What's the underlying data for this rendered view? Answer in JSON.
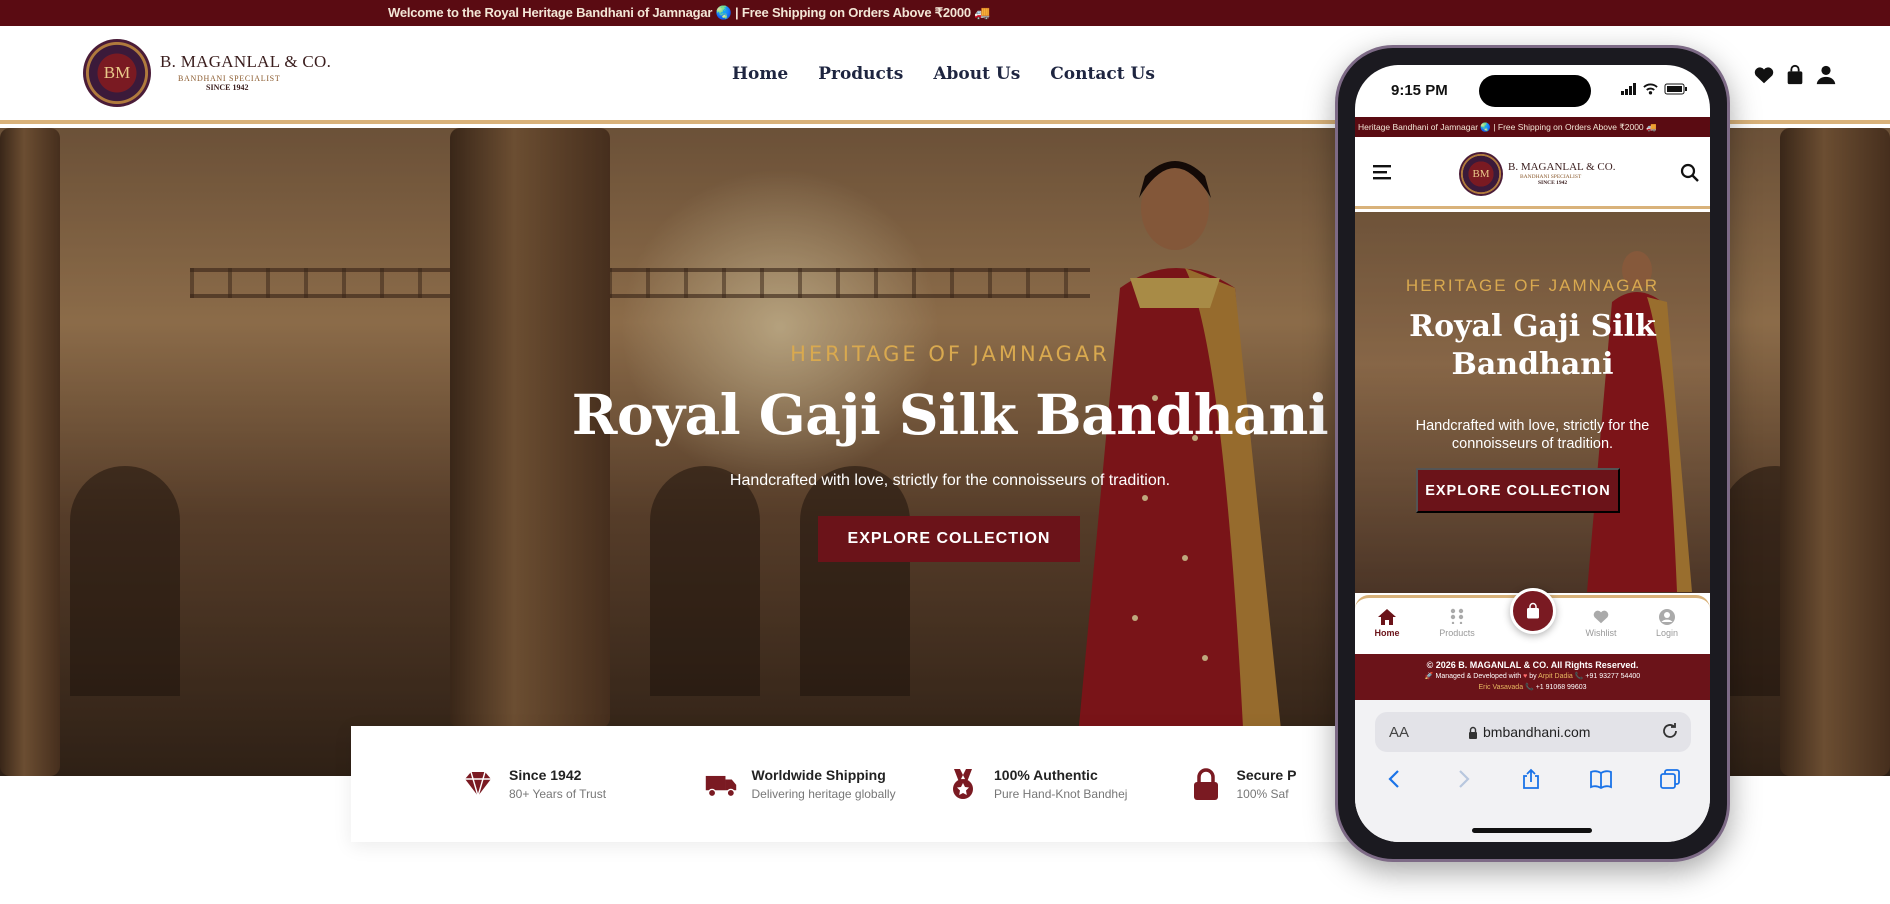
{
  "announcement": "Welcome to the Royal Heritage Bandhani of Jamnagar 🌏 | Free Shipping on Orders Above ₹2000 🚚",
  "brand": {
    "monogram": "BM",
    "name": "B. MAGANLAL & CO.",
    "tagline": "BANDHANI SPECIALIST",
    "since": "SINCE 1942"
  },
  "nav": {
    "items": [
      "Home",
      "Products",
      "About Us",
      "Contact Us"
    ]
  },
  "header_icons": [
    "heart-icon",
    "bag-icon",
    "user-icon"
  ],
  "hero": {
    "eyebrow": "HERITAGE OF JAMNAGAR",
    "title": "Royal Gaji Silk Bandhani",
    "subtitle": "Handcrafted with love, strictly for the connoisseurs of tradition.",
    "cta": "EXPLORE COLLECTION"
  },
  "features": [
    {
      "icon": "gem-icon",
      "title": "Since 1942",
      "desc": "80+ Years of Trust"
    },
    {
      "icon": "truck-icon",
      "title": "Worldwide Shipping",
      "desc": "Delivering heritage globally"
    },
    {
      "icon": "medal-icon",
      "title": "100% Authentic",
      "desc": "Pure Hand-Knot Bandhej"
    },
    {
      "icon": "lock-icon",
      "title": "Secure P",
      "desc": "100% Saf"
    }
  ],
  "mobile": {
    "time": "9:15 PM",
    "announcement": "Heritage Bandhani of Jamnagar 🌏 | Free Shipping on Orders Above ₹2000 🚚",
    "tabs": {
      "home": "Home",
      "products": "Products",
      "wishlist": "Wishlist",
      "login": "Login"
    },
    "footer": {
      "copyright": "© 2026 B. MAGANLAL & CO. All Rights Reserved.",
      "managed_prefix": "🚀 Managed & Developed with",
      "by": "by",
      "dev1": "Arpit Dadia",
      "dev1_phone": "📞 +91 93277 54400",
      "dev2": "Eric Vasavada",
      "dev2_phone": "📞 +1 91068 99603"
    },
    "safari": {
      "aa": "AA",
      "url": "bmbandhani.com"
    }
  },
  "colors": {
    "maroon": "#6b1319",
    "announcement_bg": "#5a0b12",
    "gold": "#d9a94f",
    "gold_border": "#d9b27a",
    "nav_text": "#1e2540"
  }
}
